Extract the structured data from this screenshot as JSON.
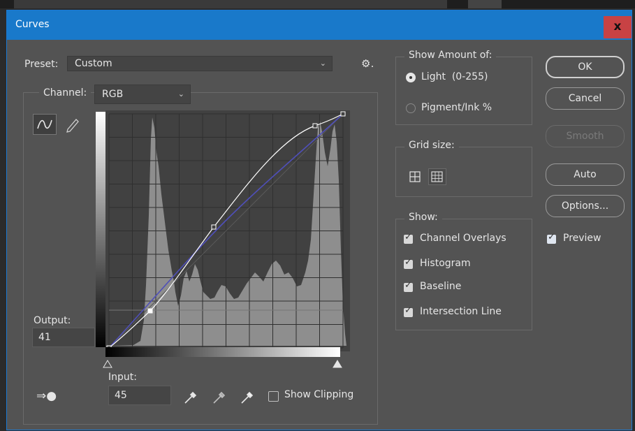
{
  "dialog": {
    "title": "Curves",
    "close_label": "x"
  },
  "preset": {
    "label": "Preset:",
    "value": "Custom"
  },
  "channel": {
    "label": "Channel:",
    "value": "RGB"
  },
  "output": {
    "label": "Output:",
    "value": "41"
  },
  "input": {
    "label": "Input:",
    "value": "45"
  },
  "show_clipping": {
    "label": "Show Clipping",
    "checked": false
  },
  "show_amount": {
    "legend": "Show Amount of:",
    "options": [
      "Light  (0-255)",
      "Pigment/Ink %"
    ],
    "selected": 0
  },
  "grid_size": {
    "legend": "Grid size:"
  },
  "show": {
    "legend": "Show:",
    "items": [
      "Channel Overlays",
      "Histogram",
      "Baseline",
      "Intersection Line"
    ]
  },
  "buttons": {
    "ok": "OK",
    "cancel": "Cancel",
    "smooth": "Smooth",
    "auto": "Auto",
    "options": "Options..."
  },
  "preview": {
    "label": "Preview",
    "checked": true
  },
  "curve_points": [
    [
      0,
      0
    ],
    [
      45,
      41
    ],
    [
      114,
      135
    ],
    [
      227,
      247
    ],
    [
      255,
      255
    ]
  ],
  "colors": {
    "title_bar": "#1979ca",
    "close_button": "#c84244",
    "panel": "#535353",
    "curve": "#ffffff",
    "overlay": "#4f4fb8"
  }
}
